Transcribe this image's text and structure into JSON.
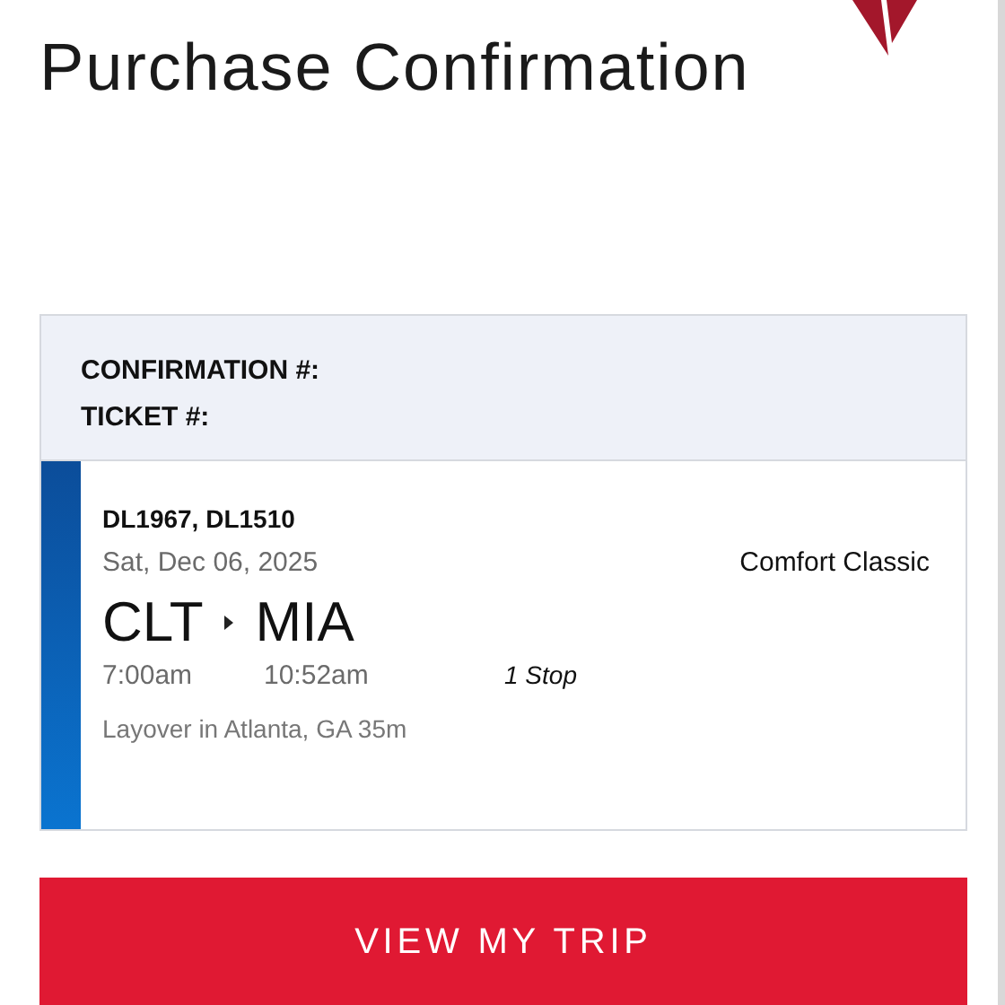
{
  "title": "Purchase Confirmation",
  "booking": {
    "confirmation_label": "CONFIRMATION #:",
    "ticket_label": "TICKET #:"
  },
  "flight": {
    "numbers": "DL1967, DL1510",
    "date": "Sat, Dec 06, 2025",
    "cabin": "Comfort Classic",
    "origin": "CLT",
    "destination": "MIA",
    "depart_time": "7:00am",
    "arrive_time": "10:52am",
    "stops": "1 Stop",
    "layover": "Layover in Atlanta, GA 35m"
  },
  "button": {
    "label": "VIEW MY TRIP"
  }
}
